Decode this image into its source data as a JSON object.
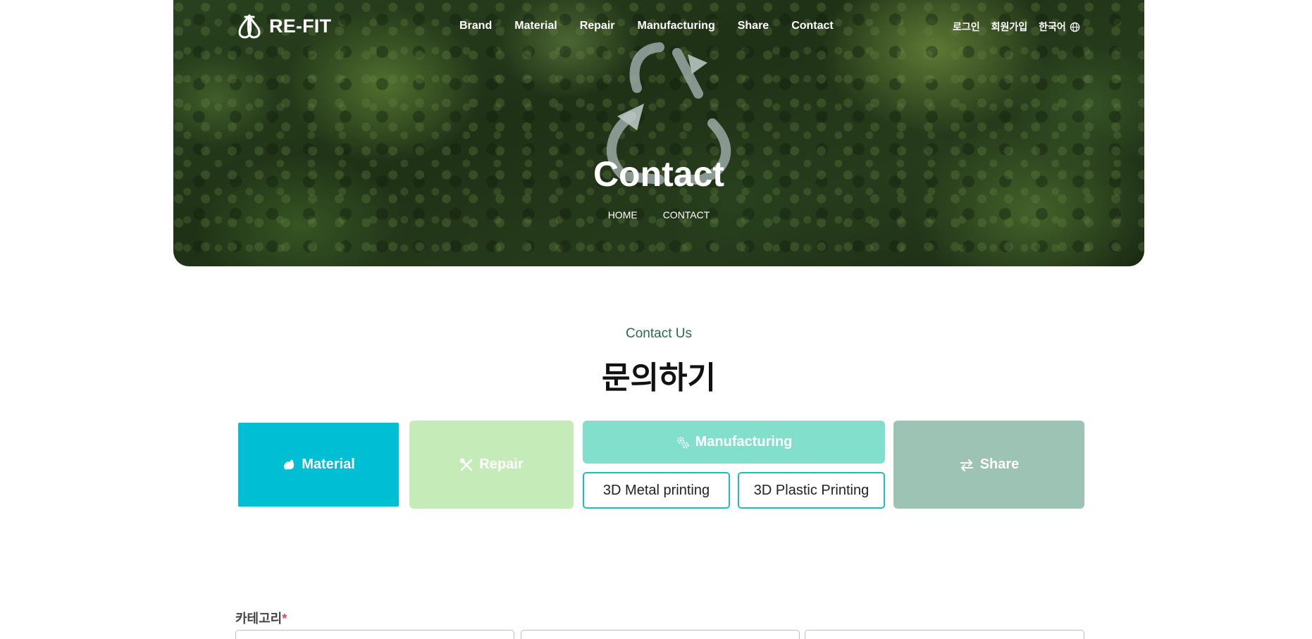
{
  "brand": {
    "name": "RE-FIT"
  },
  "nav": {
    "items": [
      "Brand",
      "Material",
      "Repair",
      "Manufacturing",
      "Share",
      "Contact"
    ],
    "login": "로그인",
    "signup": "회원가입",
    "language": "한국어"
  },
  "hero": {
    "title": "Contact",
    "breadcrumb": [
      "HOME",
      "CONTACT"
    ]
  },
  "section": {
    "eyebrow": "Contact Us",
    "title": "문의하기"
  },
  "categories": {
    "material": {
      "label": "Material",
      "icon": "material-icon",
      "color": "#00bfd4"
    },
    "repair": {
      "label": "Repair",
      "icon": "tools-icon",
      "color": "#c5ecb8"
    },
    "manufacturing": {
      "label": "Manufacturing",
      "icon": "gears-icon",
      "color": "#82dfcc"
    },
    "share": {
      "label": "Share",
      "icon": "swap-arrows-icon",
      "color": "#9cc3b4"
    },
    "sub_options": [
      "3D Metal printing",
      "3D Plastic Printing"
    ]
  },
  "form": {
    "category_label": "카테고리",
    "required_mark": "*"
  }
}
